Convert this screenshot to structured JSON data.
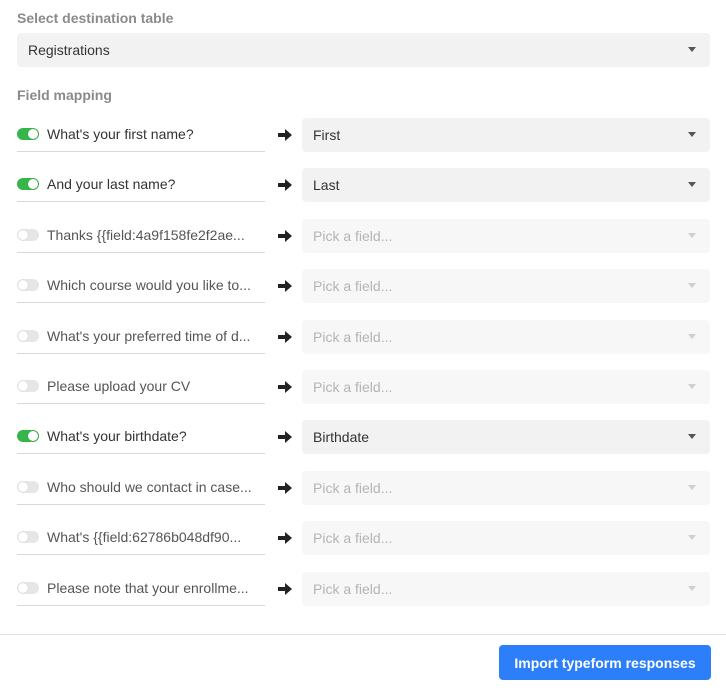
{
  "destination": {
    "label": "Select destination table",
    "selected": "Registrations"
  },
  "mapping": {
    "label": "Field mapping",
    "rows": [
      {
        "question": "What's your first name?",
        "enabled": true,
        "field": "First",
        "placeholder": false
      },
      {
        "question": "And your last name?",
        "enabled": true,
        "field": "Last",
        "placeholder": false
      },
      {
        "question": "Thanks {{field:4a9f158fe2f2ae...",
        "enabled": false,
        "field": "Pick a field...",
        "placeholder": true
      },
      {
        "question": "Which course would you like to...",
        "enabled": false,
        "field": "Pick a field...",
        "placeholder": true
      },
      {
        "question": "What's your preferred time of d...",
        "enabled": false,
        "field": "Pick a field...",
        "placeholder": true
      },
      {
        "question": "Please upload your CV",
        "enabled": false,
        "field": "Pick a field...",
        "placeholder": true
      },
      {
        "question": "What's your birthdate?",
        "enabled": true,
        "field": "Birthdate",
        "placeholder": false
      },
      {
        "question": "Who should we contact in case...",
        "enabled": false,
        "field": "Pick a field...",
        "placeholder": true
      },
      {
        "question": "What's {{field:62786b048df90...",
        "enabled": false,
        "field": "Pick a field...",
        "placeholder": true
      },
      {
        "question": "Please note that your enrollme...",
        "enabled": false,
        "field": "Pick a field...",
        "placeholder": true
      }
    ]
  },
  "footer": {
    "import_label": "Import typeform responses"
  },
  "colors": {
    "toggle_on": "#36b54a",
    "toggle_off": "#e6e6e6",
    "primary_button": "#2d7ff9"
  },
  "icons": {
    "arrow": "arrow-right-icon",
    "caret": "chevron-down-icon"
  }
}
